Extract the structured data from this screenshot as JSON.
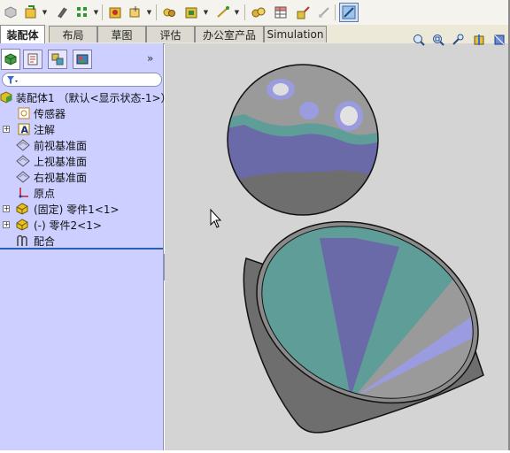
{
  "tabs": [
    {
      "label": "装配体",
      "active": true
    },
    {
      "label": "布局"
    },
    {
      "label": "草图"
    },
    {
      "label": "评估"
    },
    {
      "label": "办公室产品"
    },
    {
      "label": "Simulation"
    }
  ],
  "toolbar": {
    "icons": [
      "assembly-icon",
      "insert-components-icon",
      "mate-icon",
      "linear-pattern-icon",
      "smart-fasteners-icon",
      "move-component-icon",
      "show-hidden-icon",
      "assembly-features-icon",
      "reference-geometry-icon",
      "new-motion-study-icon",
      "bill-of-materials-icon",
      "exploded-view-icon",
      "explode-line-sketch-icon",
      "instant3d-icon"
    ]
  },
  "panel": {
    "tabs": [
      "feature-manager-tab",
      "property-manager-tab",
      "configuration-manager-tab",
      "display-manager-tab"
    ],
    "collapse_label": "»"
  },
  "tree": [
    {
      "label": "装配体1 （默认<显示状态-1>）",
      "icon": "assembly-icon",
      "expand": "-"
    },
    {
      "label": "传感器",
      "icon": "sensor-icon"
    },
    {
      "label": "注解",
      "icon": "annotation-icon",
      "expand": "+"
    },
    {
      "label": "前视基准面",
      "icon": "plane-icon"
    },
    {
      "label": "上视基准面",
      "icon": "plane-icon"
    },
    {
      "label": "右视基准面",
      "icon": "plane-icon"
    },
    {
      "label": "原点",
      "icon": "origin-icon"
    },
    {
      "label": "(固定) 零件1<1>",
      "icon": "part-icon",
      "expand": "+"
    },
    {
      "label": "(-) 零件2<1>",
      "icon": "part-icon",
      "expand": "+"
    },
    {
      "label": "配合",
      "icon": "mates-icon"
    }
  ],
  "colors": {
    "panel_bg": "#cccfff",
    "viewport_bg": "#d4d4d4",
    "teal": "#5f9e98",
    "purple": "#6b6aa8",
    "gray": "#9a9a9a",
    "dark_gray": "#6e6e6e",
    "light_purple": "#9b9be0"
  }
}
